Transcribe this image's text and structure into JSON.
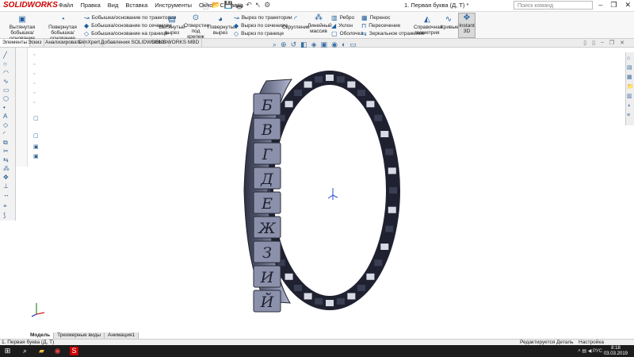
{
  "app": {
    "brand": "SOLIDWORKS",
    "doc_title": "1. Первая буква (Д, Т) *",
    "search_placeholder": "Поиск команд"
  },
  "menu": [
    "Файл",
    "Правка",
    "Вид",
    "Вставка",
    "Инструменты",
    "Окно",
    "Справка"
  ],
  "ribbon": {
    "extrude_boss": "Вытянутая бобышка/основание",
    "revolve_boss": "Повернутая бобышка/основание",
    "sweep_boss": "Бобышка/основание по траектории",
    "loft_boss": "Бобышка/основание по сечениям",
    "boundary_boss": "Бобышка/основание на границе",
    "extrude_cut": "Вытянутый вырез",
    "hole_wizard": "Отверстие под крепеж",
    "revolve_cut": "Повернутый вырез",
    "sweep_cut": "Вырез по траектории",
    "loft_cut": "Вырез по сечениям",
    "boundary_cut": "Вырез по границе",
    "fillet": "Скругление",
    "linear_pattern": "Линейный массив",
    "rib": "Ребро",
    "draft": "Уклон",
    "shell": "Оболочка",
    "wrap": "Перенос",
    "intersect": "Пересечение",
    "mirror": "Зеркальное отражение",
    "ref_geometry": "Справочная геометрия",
    "curves": "Кривые",
    "instant3d": "Instant 3D"
  },
  "tabs": [
    "Элементы",
    "Эскиз",
    "Анализировать",
    "DimXpert",
    "Добавления SOLIDWORKS",
    "SOLIDWORKS MBD"
  ],
  "model_tabs": [
    "Модель",
    "Трехмерные виды",
    "Анимация1"
  ],
  "status": {
    "left": "1. Первая буква (Д, Т)",
    "editing": "Редактируется Деталь",
    "units": "Настройка"
  },
  "taskbar": {
    "lang": "РУС",
    "time": "8:18",
    "date": "03.03.2019"
  },
  "letters": [
    "Б",
    "В",
    "Г",
    "Д",
    "Е",
    "Ж",
    "З",
    "И",
    "Й"
  ],
  "colors": {
    "accent": "#c00000",
    "ring": "#4a4f63",
    "ring_light": "#9ea4be"
  }
}
